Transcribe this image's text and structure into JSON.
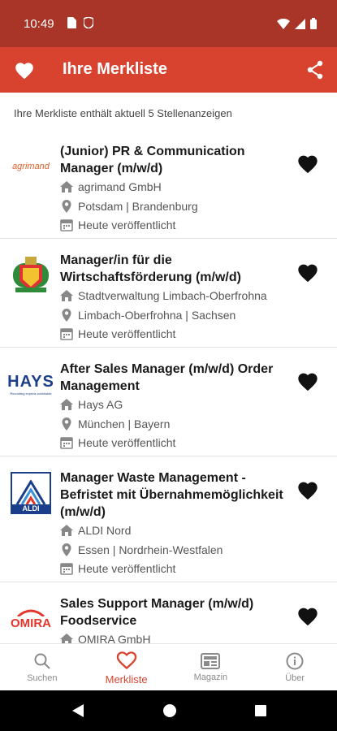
{
  "status": {
    "time": "10:49"
  },
  "header": {
    "title": "Ihre Merkliste"
  },
  "summary": "Ihre Merkliste enthält aktuell 5 Stellenanzeigen",
  "jobs": [
    {
      "logo": "agrimand",
      "title": "(Junior) PR & Communication Manager (m/w/d)",
      "company": "agrimand GmbH",
      "location": "Potsdam | Brandenburg",
      "date": "Heute veröffentlicht"
    },
    {
      "logo": "Limbach-Oberfrohna crest",
      "title": "Manager/in für die Wirtschaftsförderung (m/w/d)",
      "company": "Stadtverwaltung Limbach-Oberfrohna",
      "location": "Limbach-Oberfrohna | Sachsen",
      "date": "Heute veröffentlicht"
    },
    {
      "logo": "HAYS",
      "logo_tagline": "Recruiting experts worldwide",
      "title": "After Sales Manager (m/w/d) Order Management",
      "company": "Hays AG",
      "location": "München | Bayern",
      "date": "Heute veröffentlicht"
    },
    {
      "logo": "ALDI",
      "title": "Manager Waste Management - Befristet mit Übernahmemöglichkeit (m/w/d)",
      "company": "ALDI Nord",
      "location": "Essen | Nordrhein-Westfalen",
      "date": "Heute veröffentlicht"
    },
    {
      "logo": "OMIRA",
      "title": "Sales Support Manager (m/w/d) Foodservice",
      "company": "OMIRA GmbH"
    }
  ],
  "nav": [
    {
      "label": "Suchen",
      "icon": "search-icon"
    },
    {
      "label": "Merkliste",
      "icon": "heart-outline-icon"
    },
    {
      "label": "Magazin",
      "icon": "magazine-icon"
    },
    {
      "label": "Über",
      "icon": "info-icon"
    }
  ],
  "colors": {
    "status_bar": "#a83527",
    "app_bar": "#d8432f",
    "accent": "#d8432f"
  }
}
